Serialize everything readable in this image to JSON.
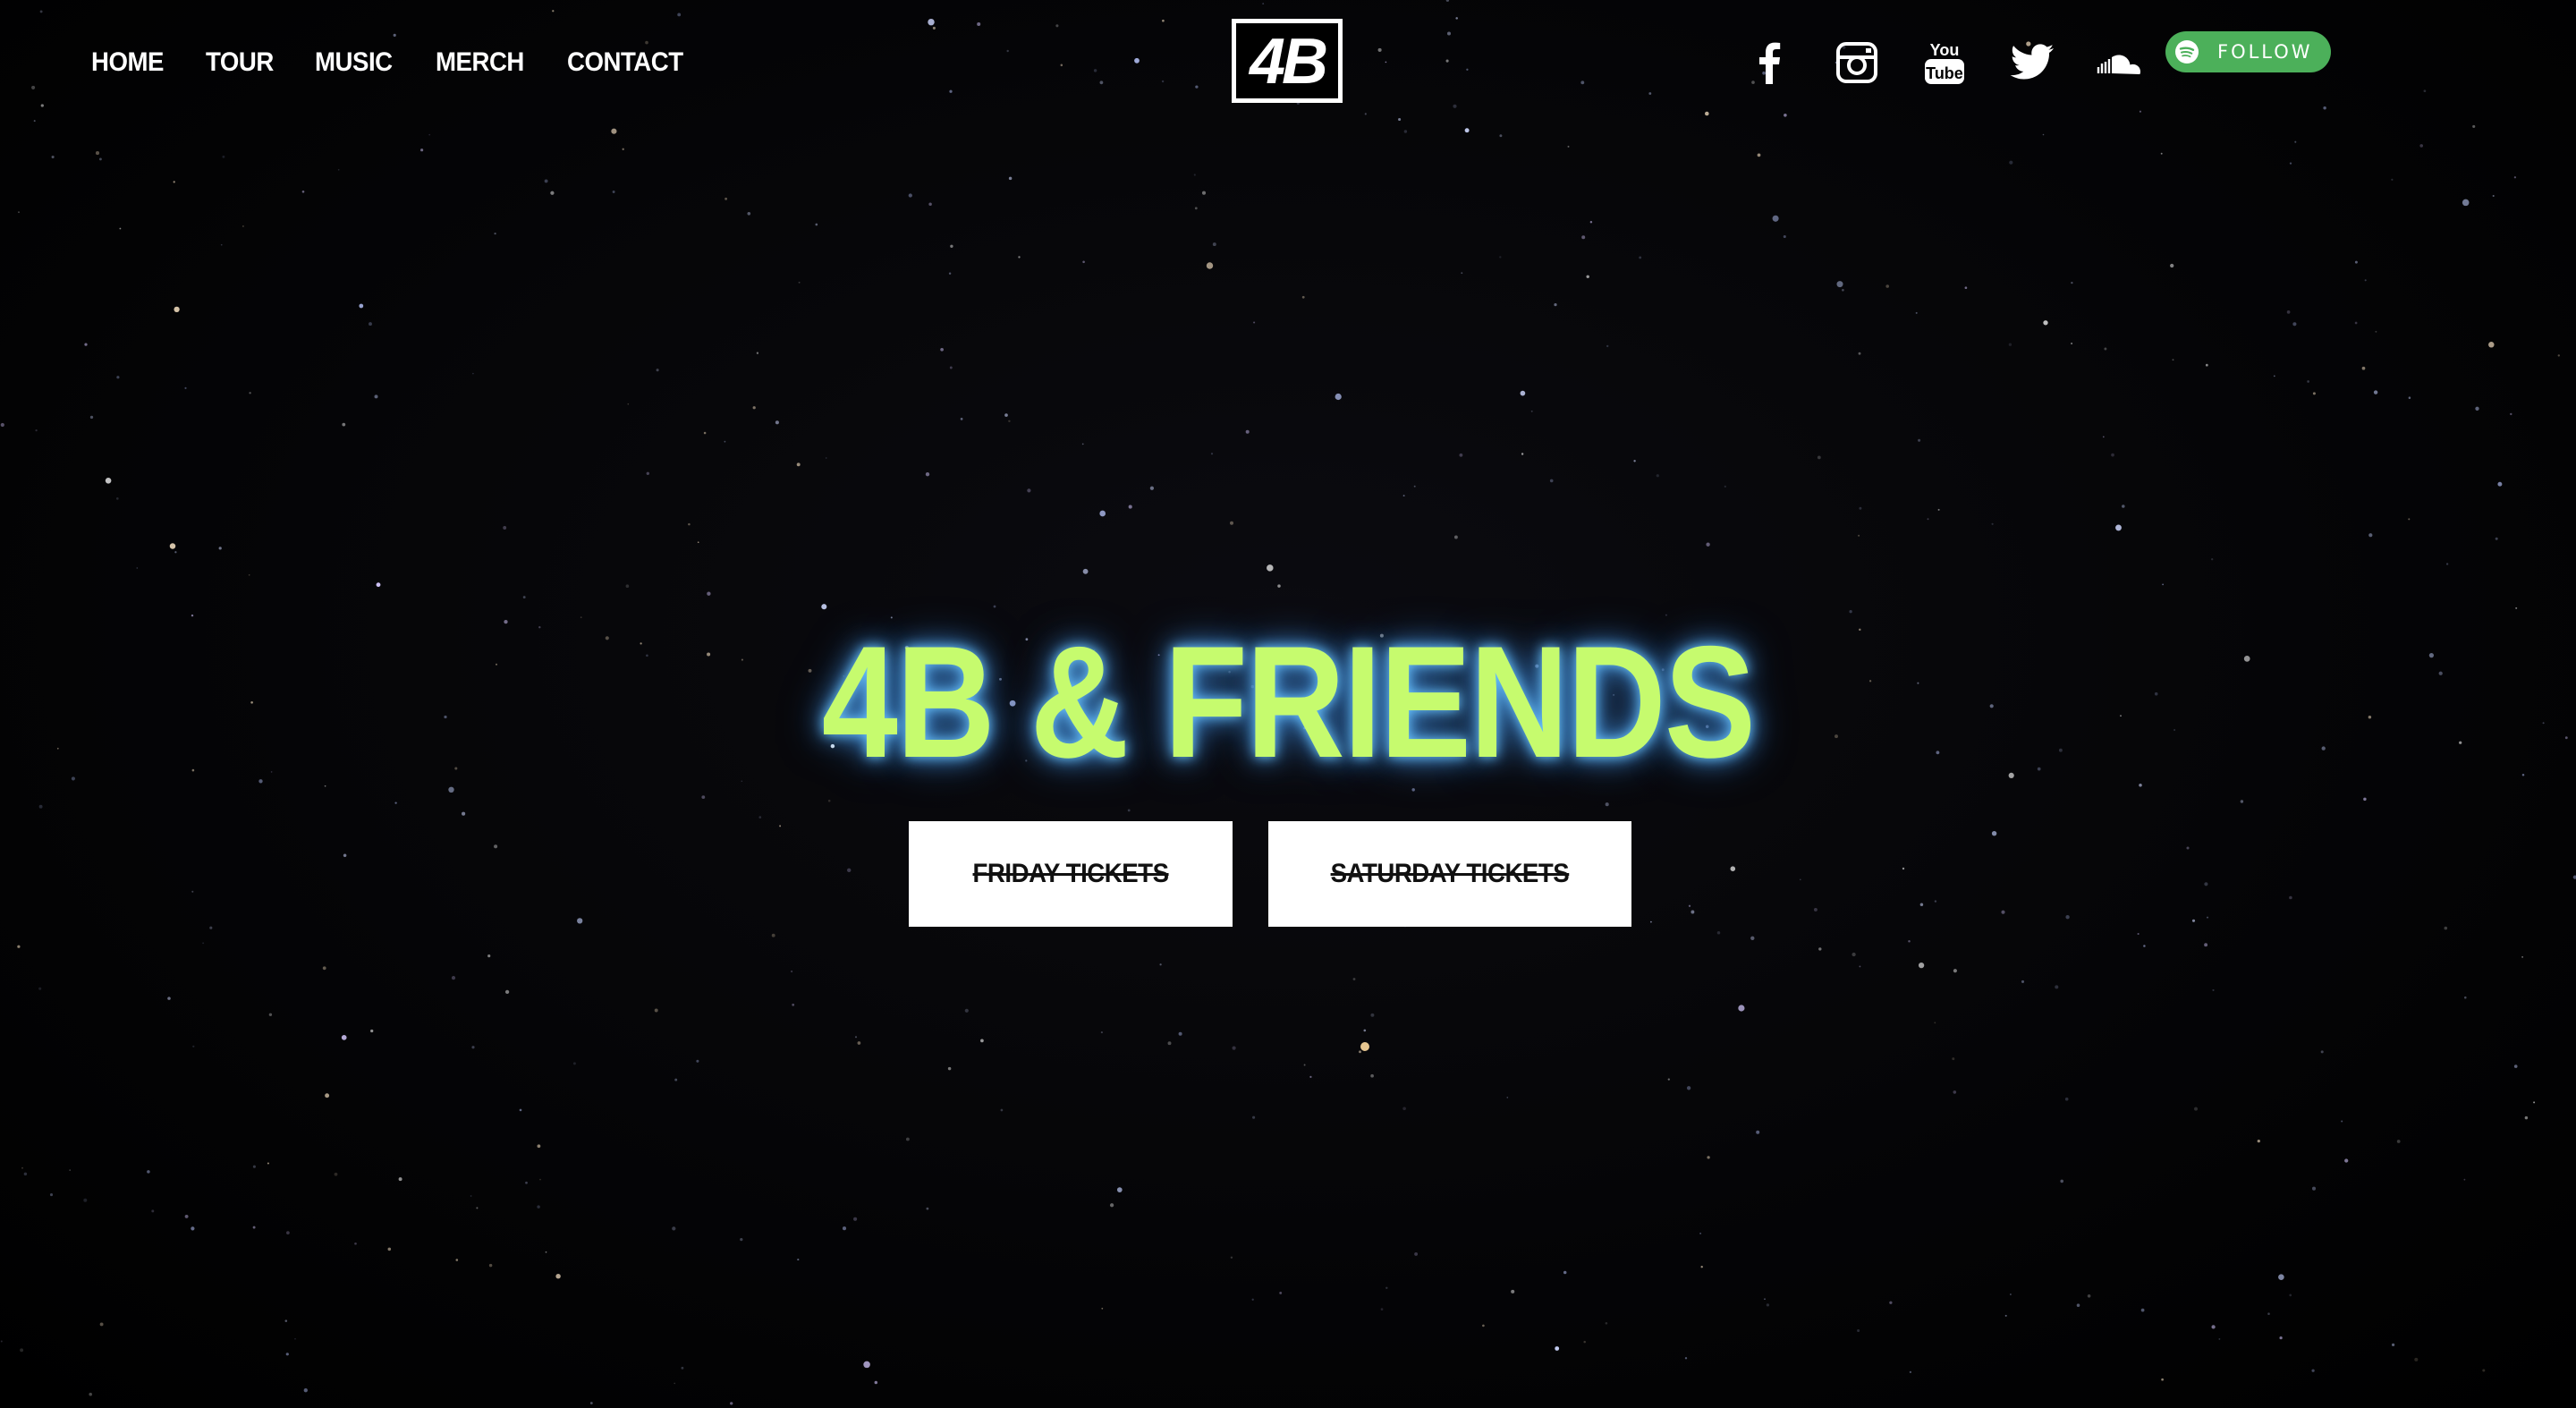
{
  "nav": {
    "items": [
      {
        "label": "HOME"
      },
      {
        "label": "TOUR"
      },
      {
        "label": "MUSIC"
      },
      {
        "label": "MERCH"
      },
      {
        "label": "CONTACT"
      }
    ]
  },
  "logo": {
    "text": "4B"
  },
  "social": {
    "icons": [
      "facebook-icon",
      "instagram-icon",
      "youtube-icon",
      "twitter-icon",
      "soundcloud-icon"
    ],
    "youtube_text_top": "You",
    "youtube_text_bottom": "Tube",
    "follow_label": "FOLLOW",
    "follow_color": "#4cb05a"
  },
  "hero": {
    "title": "4B & FRIENDS",
    "title_color": "#c6fb6e",
    "glow_color": "#5aaaff"
  },
  "tickets": {
    "friday_label": "FRIDAY TICKETS",
    "saturday_label": "SATURDAY TICKETS"
  }
}
